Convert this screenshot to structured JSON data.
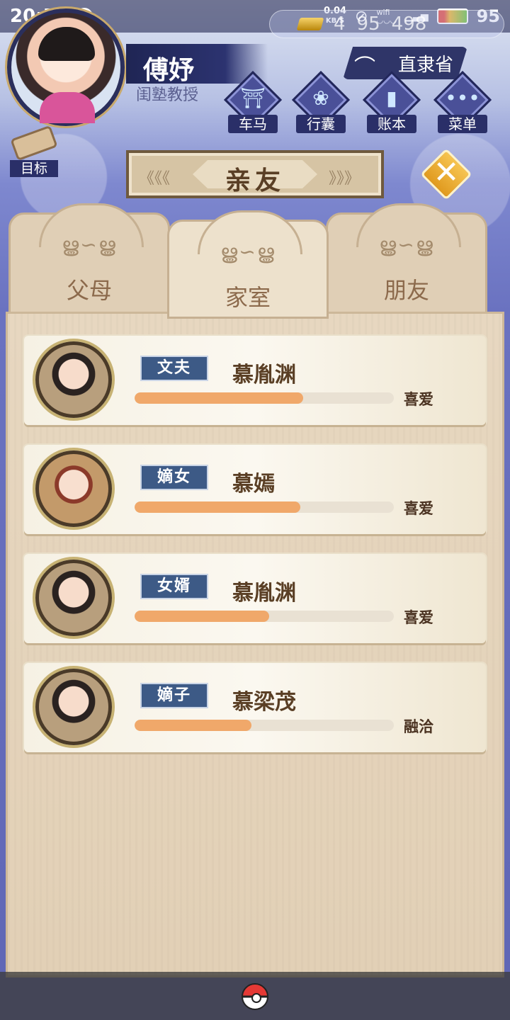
{
  "status_bar": {
    "time": "20:55",
    "net_speed_value": "0.04",
    "net_speed_unit": "KB/S",
    "battery": "95"
  },
  "resources": {
    "gold": "4",
    "silver": "95",
    "coins": "498"
  },
  "player": {
    "name": "傅妤",
    "title": "闺塾教授"
  },
  "region": "直隶省",
  "menu": [
    {
      "label": "车马",
      "icon": "carriage-icon"
    },
    {
      "label": "行囊",
      "icon": "bag-icon"
    },
    {
      "label": "账本",
      "icon": "ledger-icon"
    },
    {
      "label": "菜单",
      "icon": "more-icon"
    }
  ],
  "goal_label": "目标",
  "panel_title": "亲友",
  "tabs": [
    {
      "label": "父母",
      "active": false
    },
    {
      "label": "家室",
      "active": true
    },
    {
      "label": "朋友",
      "active": false
    }
  ],
  "relatives": [
    {
      "relation": "文夫",
      "name": "慕胤渊",
      "status": "喜爱",
      "affinity": 0.65
    },
    {
      "relation": "嫡女",
      "name": "慕嫣",
      "status": "喜爱",
      "affinity": 0.64
    },
    {
      "relation": "女婿",
      "name": "慕胤渊",
      "status": "喜爱",
      "affinity": 0.52
    },
    {
      "relation": "嫡子",
      "name": "慕梁茂",
      "status": "融洽",
      "affinity": 0.45
    }
  ],
  "colors": {
    "accent_bar": "#f0a86a",
    "relation_tag": "#3d5a86",
    "title_text": "#5a3f25"
  }
}
